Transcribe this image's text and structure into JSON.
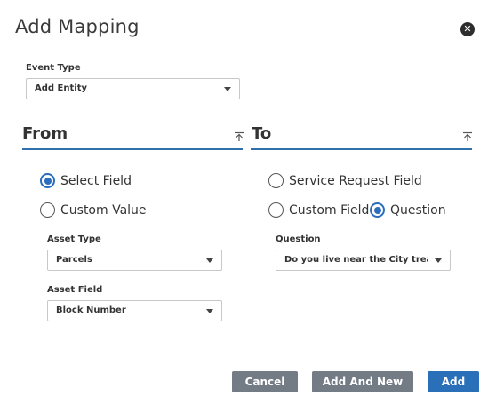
{
  "dialog": {
    "title": "Add Mapping",
    "close_icon": "close-icon"
  },
  "event_type": {
    "label": "Event Type",
    "value": "Add Entity"
  },
  "from": {
    "title": "From",
    "options": {
      "select_field": "Select Field",
      "custom_value": "Custom Value"
    },
    "selected": "select_field",
    "asset_type": {
      "label": "Asset Type",
      "value": "Parcels"
    },
    "asset_field": {
      "label": "Asset Field",
      "value": "Block Number"
    }
  },
  "to": {
    "title": "To",
    "options": {
      "service_request_field": "Service Request Field",
      "custom_field": "Custom Field",
      "question": "Question"
    },
    "selected": "question",
    "question": {
      "label": "Question",
      "value": "Do you live near the City treat..."
    }
  },
  "buttons": {
    "cancel": "Cancel",
    "add_and_new": "Add And New",
    "add": "Add"
  },
  "colors": {
    "accent": "#2a70b8",
    "secondary_button": "#737b85"
  }
}
